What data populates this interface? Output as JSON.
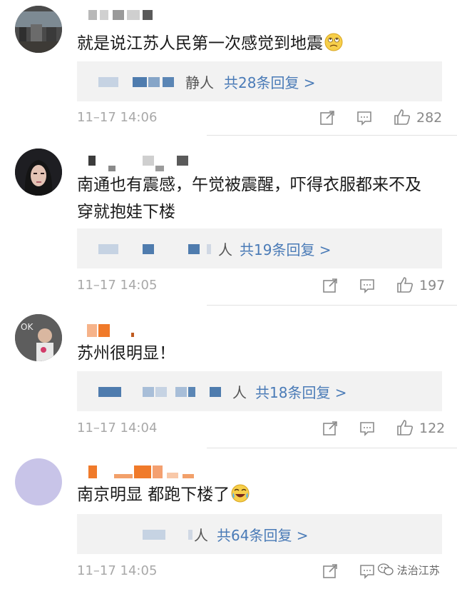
{
  "comments": [
    {
      "text": "就是说江苏人民第一次感觉到地震",
      "emoji": "pensive-rolling-eyes-emoji",
      "reply_prefix": "静人",
      "reply_link": "共28条回复 >",
      "time": "11–17 14:06",
      "likes": "282"
    },
    {
      "text_line1": "南通也有震感，午觉被震醒，吓得衣服都来不及",
      "text_line2": "穿就抱娃下楼",
      "reply_prefix": "人",
      "reply_link": "共19条回复 >",
      "time": "11–17 14:05",
      "likes": "197"
    },
    {
      "text": "苏州很明显！",
      "reply_prefix": "人",
      "reply_link": "共18条回复 >",
      "time": "11–17 14:04",
      "likes": "122"
    },
    {
      "text": "南京明显 都跑下楼了",
      "emoji": "crying-laughing-emoji",
      "reply_prefix": "人",
      "reply_link": "共64条回复 >",
      "time": "11–17 14:05"
    }
  ],
  "watermark": {
    "text": "法治江苏",
    "icon": "wechat-icon"
  },
  "colors": {
    "link": "#4a7bb7",
    "time": "#a8a8a8",
    "reply_bg": "#f2f2f2",
    "mosaic_blue": "#4f7cae",
    "mosaic_orange": "#f07a2a"
  }
}
